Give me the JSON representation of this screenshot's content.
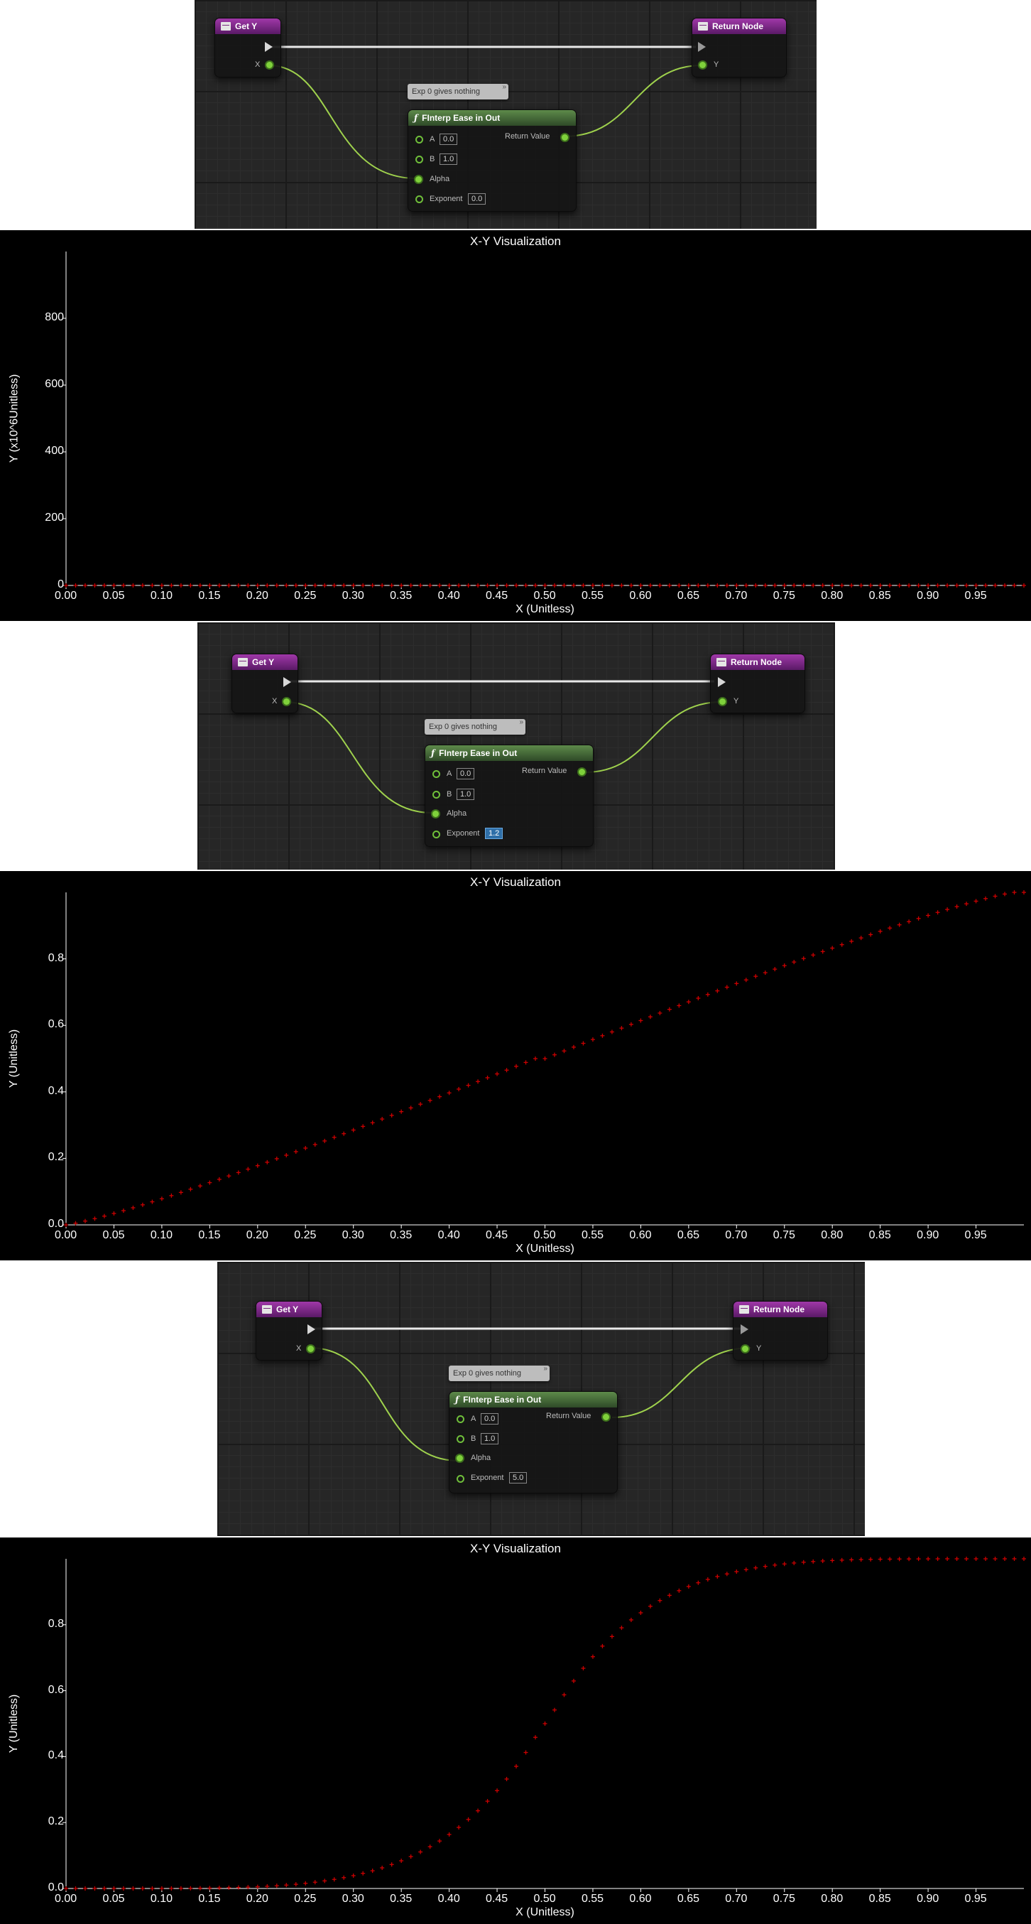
{
  "panels": [
    {
      "graph": {
        "get_y_title": "Get Y",
        "return_title": "Return Node",
        "x_pin": "X",
        "y_pin": "Y",
        "comment": "Exp 0 gives nothing",
        "func_title": "FInterp Ease in Out",
        "pin_a": "A",
        "a_val": "0.0",
        "pin_b": "B",
        "b_val": "1.0",
        "pin_alpha": "Alpha",
        "pin_exponent": "Exponent",
        "exponent_val": "0.0",
        "return_value": "Return Value"
      },
      "chart": {
        "title": "X-Y Visualization",
        "xlabel": "X (Unitless)",
        "ylabel": "Y (x10^6Unitless)",
        "xticks": [
          "0.00",
          "0.05",
          "0.10",
          "0.15",
          "0.20",
          "0.25",
          "0.30",
          "0.35",
          "0.40",
          "0.45",
          "0.50",
          "0.55",
          "0.60",
          "0.65",
          "0.70",
          "0.75",
          "0.80",
          "0.85",
          "0.90",
          "0.95"
        ],
        "yticks": [
          "0",
          "200",
          "400",
          "600",
          "800"
        ]
      }
    },
    {
      "graph": {
        "get_y_title": "Get Y",
        "return_title": "Return Node",
        "x_pin": "X",
        "y_pin": "Y",
        "comment": "Exp 0 gives nothing",
        "func_title": "FInterp Ease in Out",
        "pin_a": "A",
        "a_val": "0.0",
        "pin_b": "B",
        "b_val": "1.0",
        "pin_alpha": "Alpha",
        "pin_exponent": "Exponent",
        "exponent_val": "1.2",
        "return_value": "Return Value"
      },
      "chart": {
        "title": "X-Y Visualization",
        "xlabel": "X (Unitless)",
        "ylabel": "Y (Unitless)",
        "xticks": [
          "0.00",
          "0.05",
          "0.10",
          "0.15",
          "0.20",
          "0.25",
          "0.30",
          "0.35",
          "0.40",
          "0.45",
          "0.50",
          "0.55",
          "0.60",
          "0.65",
          "0.70",
          "0.75",
          "0.80",
          "0.85",
          "0.90",
          "0.95"
        ],
        "yticks": [
          "0.0",
          "0.2",
          "0.4",
          "0.6",
          "0.8"
        ]
      }
    },
    {
      "graph": {
        "get_y_title": "Get Y",
        "return_title": "Return Node",
        "x_pin": "X",
        "y_pin": "Y",
        "comment": "Exp 0 gives nothing",
        "func_title": "FInterp Ease in Out",
        "pin_a": "A",
        "a_val": "0.0",
        "pin_b": "B",
        "b_val": "1.0",
        "pin_alpha": "Alpha",
        "pin_exponent": "Exponent",
        "exponent_val": "5.0",
        "return_value": "Return Value"
      },
      "chart": {
        "title": "X-Y Visualization",
        "xlabel": "X (Unitless)",
        "ylabel": "Y (Unitless)",
        "xticks": [
          "0.00",
          "0.05",
          "0.10",
          "0.15",
          "0.20",
          "0.25",
          "0.30",
          "0.35",
          "0.40",
          "0.45",
          "0.50",
          "0.55",
          "0.60",
          "0.65",
          "0.70",
          "0.75",
          "0.80",
          "0.85",
          "0.90",
          "0.95"
        ],
        "yticks": [
          "0.0",
          "0.2",
          "0.4",
          "0.6",
          "0.8"
        ]
      }
    }
  ],
  "chart_data": [
    {
      "type": "scatter",
      "title": "X-Y Visualization",
      "xlabel": "X (Unitless)",
      "ylabel": "Y (x10^6Unitless)",
      "xlim": [
        0,
        1
      ],
      "ylim": [
        0,
        1000
      ],
      "marker": "+",
      "color": "#cc0000",
      "grid": false,
      "exponent": 0.0,
      "x": [
        0.0,
        0.01,
        0.02,
        0.03,
        0.04,
        0.05,
        0.06,
        0.07,
        0.08,
        0.09,
        0.1,
        0.11,
        0.12,
        0.13,
        0.14,
        0.15,
        0.16,
        0.17,
        0.18,
        0.19,
        0.2,
        0.21,
        0.22,
        0.23,
        0.24,
        0.25,
        0.26,
        0.27,
        0.28,
        0.29,
        0.3,
        0.31,
        0.32,
        0.33,
        0.34,
        0.35,
        0.36,
        0.37,
        0.38,
        0.39,
        0.4,
        0.41,
        0.42,
        0.43,
        0.44,
        0.45,
        0.46,
        0.47,
        0.48,
        0.49,
        0.5,
        0.51,
        0.52,
        0.53,
        0.54,
        0.55,
        0.56,
        0.57,
        0.58,
        0.59,
        0.6,
        0.61,
        0.62,
        0.63,
        0.64,
        0.65,
        0.66,
        0.67,
        0.68,
        0.69,
        0.7,
        0.71,
        0.72,
        0.73,
        0.74,
        0.75,
        0.76,
        0.77,
        0.78,
        0.79,
        0.8,
        0.81,
        0.82,
        0.83,
        0.84,
        0.85,
        0.86,
        0.87,
        0.88,
        0.89,
        0.9,
        0.91,
        0.92,
        0.93,
        0.94,
        0.95,
        0.96,
        0.97,
        0.98,
        0.99,
        1.0
      ],
      "y": [
        0,
        0,
        0,
        0,
        0,
        0,
        0,
        0,
        0,
        0,
        0,
        0,
        0,
        0,
        0,
        0,
        0,
        0,
        0,
        0,
        0,
        0,
        0,
        0,
        0,
        0,
        0,
        0,
        0,
        0,
        0,
        0,
        0,
        0,
        0,
        0,
        0,
        0,
        0,
        0,
        0,
        0,
        0,
        0,
        0,
        0,
        0,
        0,
        0,
        0,
        0,
        0,
        0,
        0,
        0,
        0,
        0,
        0,
        0,
        0,
        0,
        0,
        0,
        0,
        0,
        0,
        0,
        0,
        0,
        0,
        0,
        0,
        0,
        0,
        0,
        0,
        0,
        0,
        0,
        0,
        0,
        0,
        0,
        0,
        0,
        0,
        0,
        0,
        0,
        0,
        0,
        0,
        0,
        0,
        0,
        0,
        0,
        0,
        0,
        0,
        0
      ]
    },
    {
      "type": "scatter",
      "title": "X-Y Visualization",
      "xlabel": "X (Unitless)",
      "ylabel": "Y (Unitless)",
      "xlim": [
        0,
        1
      ],
      "ylim": [
        0,
        1
      ],
      "marker": "+",
      "color": "#cc0000",
      "grid": false,
      "exponent": 1.2,
      "x": [
        0.0,
        0.01,
        0.02,
        0.03,
        0.04,
        0.05,
        0.06,
        0.07,
        0.08,
        0.09,
        0.1,
        0.11,
        0.12,
        0.13,
        0.14,
        0.15,
        0.16,
        0.17,
        0.18,
        0.19,
        0.2,
        0.21,
        0.22,
        0.23,
        0.24,
        0.25,
        0.26,
        0.27,
        0.28,
        0.29,
        0.3,
        0.31,
        0.32,
        0.33,
        0.34,
        0.35,
        0.36,
        0.37,
        0.38,
        0.39,
        0.4,
        0.41,
        0.42,
        0.43,
        0.44,
        0.45,
        0.46,
        0.47,
        0.48,
        0.49,
        0.5,
        0.51,
        0.52,
        0.53,
        0.54,
        0.55,
        0.56,
        0.57,
        0.58,
        0.59,
        0.6,
        0.61,
        0.62,
        0.63,
        0.64,
        0.65,
        0.66,
        0.67,
        0.68,
        0.69,
        0.7,
        0.71,
        0.72,
        0.73,
        0.74,
        0.75,
        0.76,
        0.77,
        0.78,
        0.79,
        0.8,
        0.81,
        0.82,
        0.83,
        0.84,
        0.85,
        0.86,
        0.87,
        0.88,
        0.89,
        0.9,
        0.91,
        0.92,
        0.93,
        0.94,
        0.95,
        0.96,
        0.97,
        0.98,
        0.99,
        1.0
      ],
      "y": [
        0,
        0.005,
        0.0115,
        0.0187,
        0.0264,
        0.0344,
        0.0428,
        0.0514,
        0.0603,
        0.0694,
        0.0786,
        0.088,
        0.0976,
        0.1073,
        0.1171,
        0.127,
        0.137,
        0.1471,
        0.1573,
        0.1676,
        0.178,
        0.1884,
        0.1989,
        0.2095,
        0.2202,
        0.2309,
        0.2416,
        0.2524,
        0.2633,
        0.2742,
        0.2852,
        0.2962,
        0.3072,
        0.3183,
        0.3294,
        0.3406,
        0.3518,
        0.363,
        0.3743,
        0.3856,
        0.3969,
        0.4083,
        0.4197,
        0.4311,
        0.4425,
        0.454,
        0.4654,
        0.4769,
        0.4885,
        0.5,
        0.5,
        0.5115,
        0.5231,
        0.5346,
        0.546,
        0.5575,
        0.5689,
        0.5803,
        0.5917,
        0.6031,
        0.6144,
        0.6257,
        0.637,
        0.6482,
        0.6594,
        0.6706,
        0.6817,
        0.6928,
        0.7038,
        0.7148,
        0.7258,
        0.7367,
        0.7476,
        0.7584,
        0.7691,
        0.7798,
        0.7905,
        0.8011,
        0.8116,
        0.822,
        0.8324,
        0.8427,
        0.8529,
        0.863,
        0.873,
        0.8829,
        0.8927,
        0.9024,
        0.912,
        0.9214,
        0.9306,
        0.9397,
        0.9486,
        0.9572,
        0.9656,
        0.9736,
        0.9813,
        0.9885,
        0.995,
        1.0,
        1.0
      ]
    },
    {
      "type": "scatter",
      "title": "X-Y Visualization",
      "xlabel": "X (Unitless)",
      "ylabel": "Y (Unitless)",
      "xlim": [
        0,
        1
      ],
      "ylim": [
        0,
        1
      ],
      "marker": "+",
      "color": "#cc0000",
      "grid": false,
      "exponent": 5.0,
      "x": [
        0.0,
        0.01,
        0.02,
        0.03,
        0.04,
        0.05,
        0.06,
        0.07,
        0.08,
        0.09,
        0.1,
        0.11,
        0.12,
        0.13,
        0.14,
        0.15,
        0.16,
        0.17,
        0.18,
        0.19,
        0.2,
        0.21,
        0.22,
        0.23,
        0.24,
        0.25,
        0.26,
        0.27,
        0.28,
        0.29,
        0.3,
        0.31,
        0.32,
        0.33,
        0.34,
        0.35,
        0.36,
        0.37,
        0.38,
        0.39,
        0.4,
        0.41,
        0.42,
        0.43,
        0.44,
        0.45,
        0.46,
        0.47,
        0.48,
        0.49,
        0.5,
        0.51,
        0.52,
        0.53,
        0.54,
        0.55,
        0.56,
        0.57,
        0.58,
        0.59,
        0.6,
        0.61,
        0.62,
        0.63,
        0.64,
        0.65,
        0.66,
        0.67,
        0.68,
        0.69,
        0.7,
        0.71,
        0.72,
        0.73,
        0.74,
        0.75,
        0.76,
        0.77,
        0.78,
        0.79,
        0.8,
        0.81,
        0.82,
        0.83,
        0.84,
        0.85,
        0.86,
        0.87,
        0.88,
        0.89,
        0.9,
        0.91,
        0.92,
        0.93,
        0.94,
        0.95,
        0.96,
        0.97,
        0.98,
        0.99,
        1.0
      ],
      "y": [
        0,
        0,
        0,
        0,
        0,
        0,
        0,
        0,
        0,
        0,
        0.0002,
        0.0003,
        0.0004,
        0.0006,
        0.0009,
        0.0012,
        0.0017,
        0.0023,
        0.003,
        0.004,
        0.0051,
        0.0065,
        0.0083,
        0.0103,
        0.0127,
        0.0156,
        0.019,
        0.023,
        0.0275,
        0.0328,
        0.0389,
        0.0459,
        0.0537,
        0.0626,
        0.0727,
        0.084,
        0.0967,
        0.1108,
        0.1266,
        0.144,
        0.1638,
        0.1853,
        0.2093,
        0.2357,
        0.2648,
        0.2969,
        0.332,
        0.3705,
        0.4126,
        0.4585,
        0.5,
        0.5415,
        0.5874,
        0.6295,
        0.668,
        0.7031,
        0.7352,
        0.7643,
        0.7907,
        0.8147,
        0.8362,
        0.856,
        0.8734,
        0.8892,
        0.9033,
        0.916,
        0.9273,
        0.9374,
        0.9463,
        0.9541,
        0.9611,
        0.9672,
        0.9725,
        0.977,
        0.981,
        0.9844,
        0.9873,
        0.9897,
        0.9917,
        0.9935,
        0.9949,
        0.996,
        0.997,
        0.9977,
        0.9983,
        0.9988,
        0.9991,
        0.9994,
        0.9996,
        0.9997,
        0.9998,
        0.9999,
        1.0,
        1.0,
        1.0,
        1.0,
        1.0,
        1.0,
        1.0,
        1.0,
        1.0
      ]
    }
  ]
}
